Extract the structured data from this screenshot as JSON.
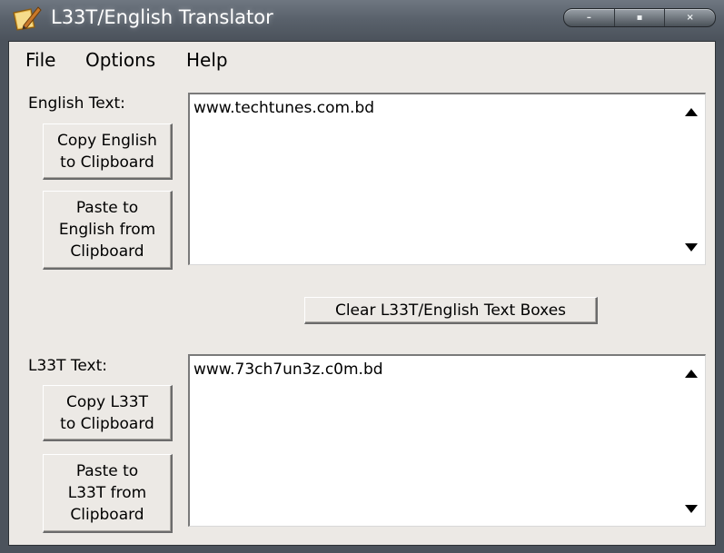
{
  "window": {
    "title": "L33T/English Translator",
    "minimize_glyph": "–",
    "maximize_glyph": "▪",
    "close_glyph": "×"
  },
  "menu": {
    "items": [
      {
        "label": "File"
      },
      {
        "label": "Options"
      },
      {
        "label": "Help"
      }
    ]
  },
  "english": {
    "label": "English Text:",
    "text": "www.techtunes.com.bd",
    "copy_button": "Copy English\nto Clipboard",
    "paste_button": "Paste to\nEnglish from\nClipboard"
  },
  "clear_button": "Clear L33T/English Text Boxes",
  "leet": {
    "label": "L33T Text:",
    "text": "www.73ch7un3z.c0m.bd",
    "copy_button": "Copy L33T\nto Clipboard",
    "paste_button": "Paste to\nL33T from\nClipboard"
  },
  "colors": {
    "client_background": "#ece9e5",
    "titlebar": "#59616b"
  },
  "icons": {
    "app": "notepad-pen-icon",
    "scroll_up": "triangle-up-icon",
    "scroll_down": "triangle-down-icon"
  }
}
